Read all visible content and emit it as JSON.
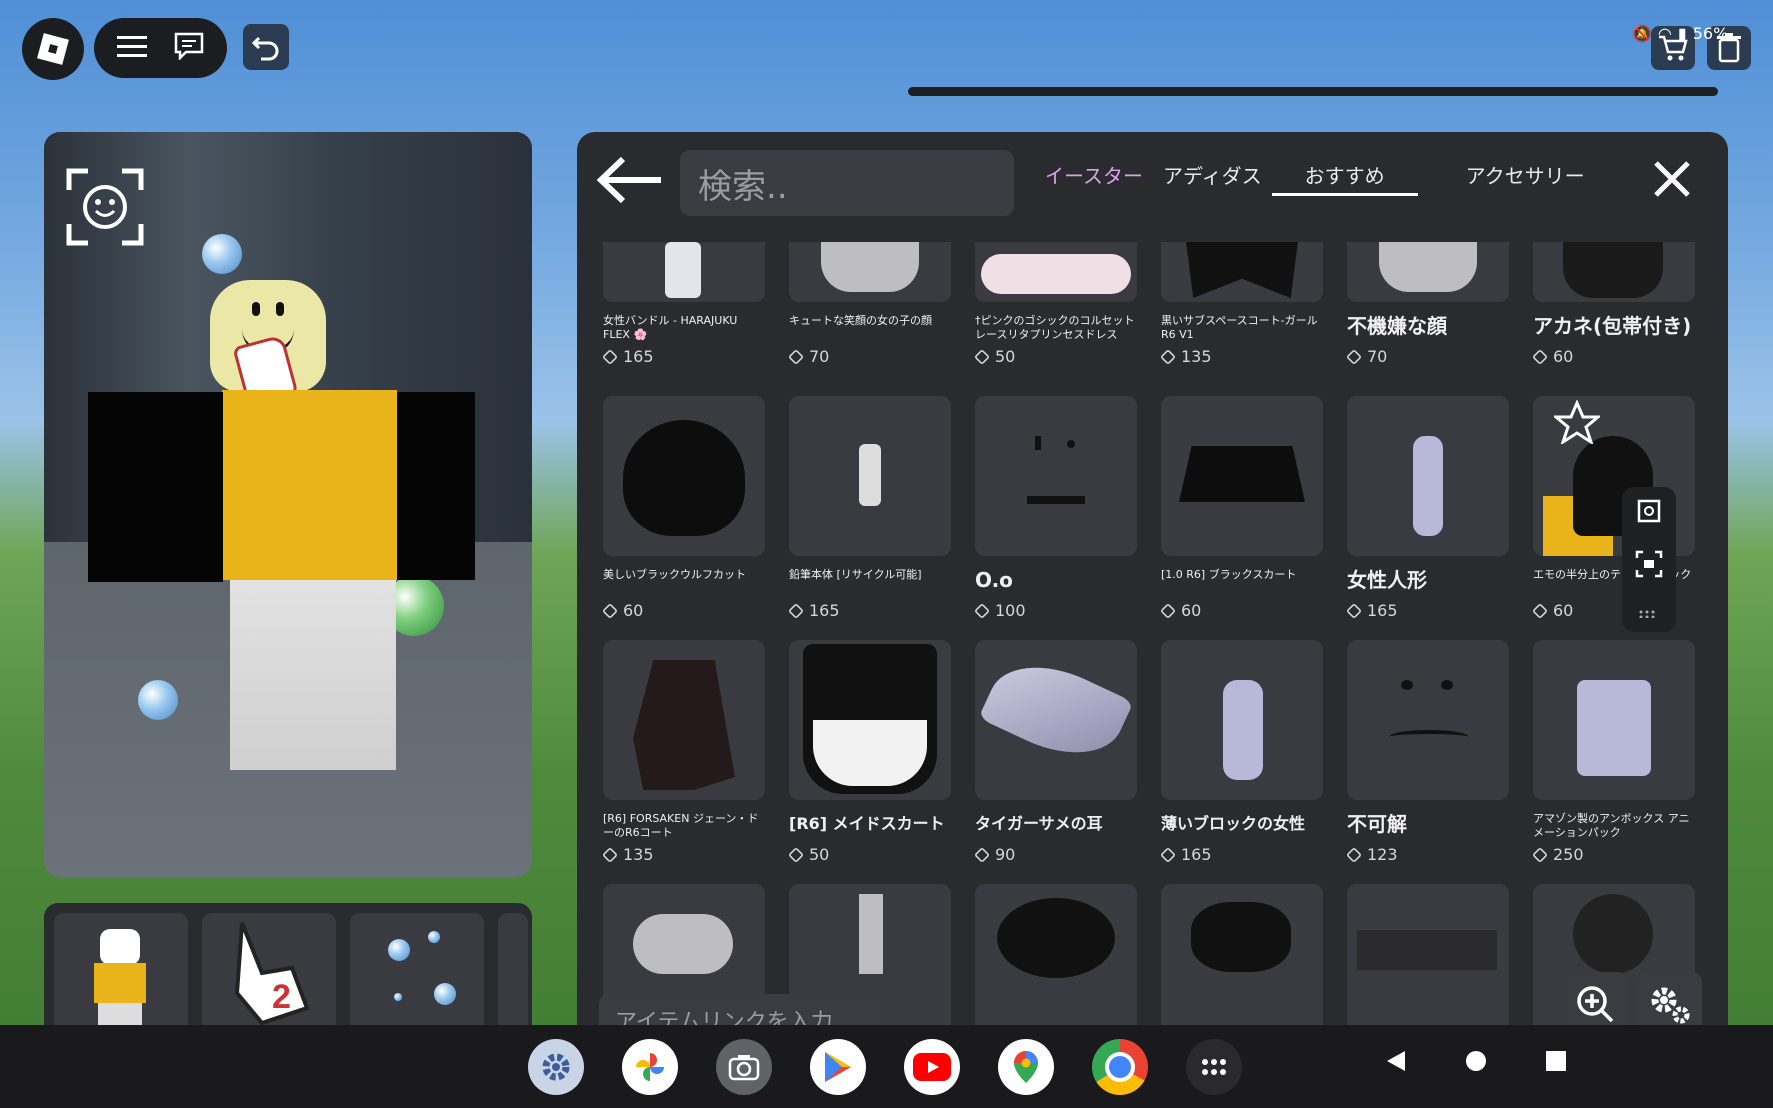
{
  "search": {
    "placeholder": "検索.."
  },
  "tabs": [
    {
      "label": "イースター"
    },
    {
      "label": "アディダス"
    },
    {
      "label": "おすすめ"
    },
    {
      "label": "アクセサリー"
    }
  ],
  "items": [
    {
      "name": "女性バンドル - HARAJUKU FLEX 🌸",
      "price": "165"
    },
    {
      "name": "キュートな笑顔の女の子の顔",
      "price": "70"
    },
    {
      "name": "†ピンクのゴシックのコルセットレースリタプリンセスドレス",
      "price": "50"
    },
    {
      "name": "黒いサブスペースコート-ガールR6 V1",
      "price": "135"
    },
    {
      "name": "不機嫌な顔",
      "price": "70"
    },
    {
      "name": "アカネ(包帯付き)",
      "price": "60"
    },
    {
      "name": "美しいブラックウルフカット",
      "price": "60"
    },
    {
      "name": "鉛筆本体 [リサイクル可能]",
      "price": "165"
    },
    {
      "name": "O.o",
      "price": "100"
    },
    {
      "name": "[1.0 R6] ブラックスカート",
      "price": "60"
    },
    {
      "name": "女性人形",
      "price": "165"
    },
    {
      "name": "エモの半分上のテール(ブラック",
      "price": "60"
    },
    {
      "name": "[R6] FORSAKEN ジェーン・ドーのR6コート",
      "price": "135"
    },
    {
      "name": "[R6] メイドスカート",
      "price": "50"
    },
    {
      "name": "タイガーサメの耳",
      "price": "90"
    },
    {
      "name": "薄いブロックの女性",
      "price": "165"
    },
    {
      "name": "不可解",
      "price": "123"
    },
    {
      "name": "アマゾン製のアンボックス アニメーションパック",
      "price": "250"
    }
  ],
  "link_input": {
    "placeholder": "アイテムリンクを入力.."
  },
  "status": {
    "battery": "56%"
  }
}
